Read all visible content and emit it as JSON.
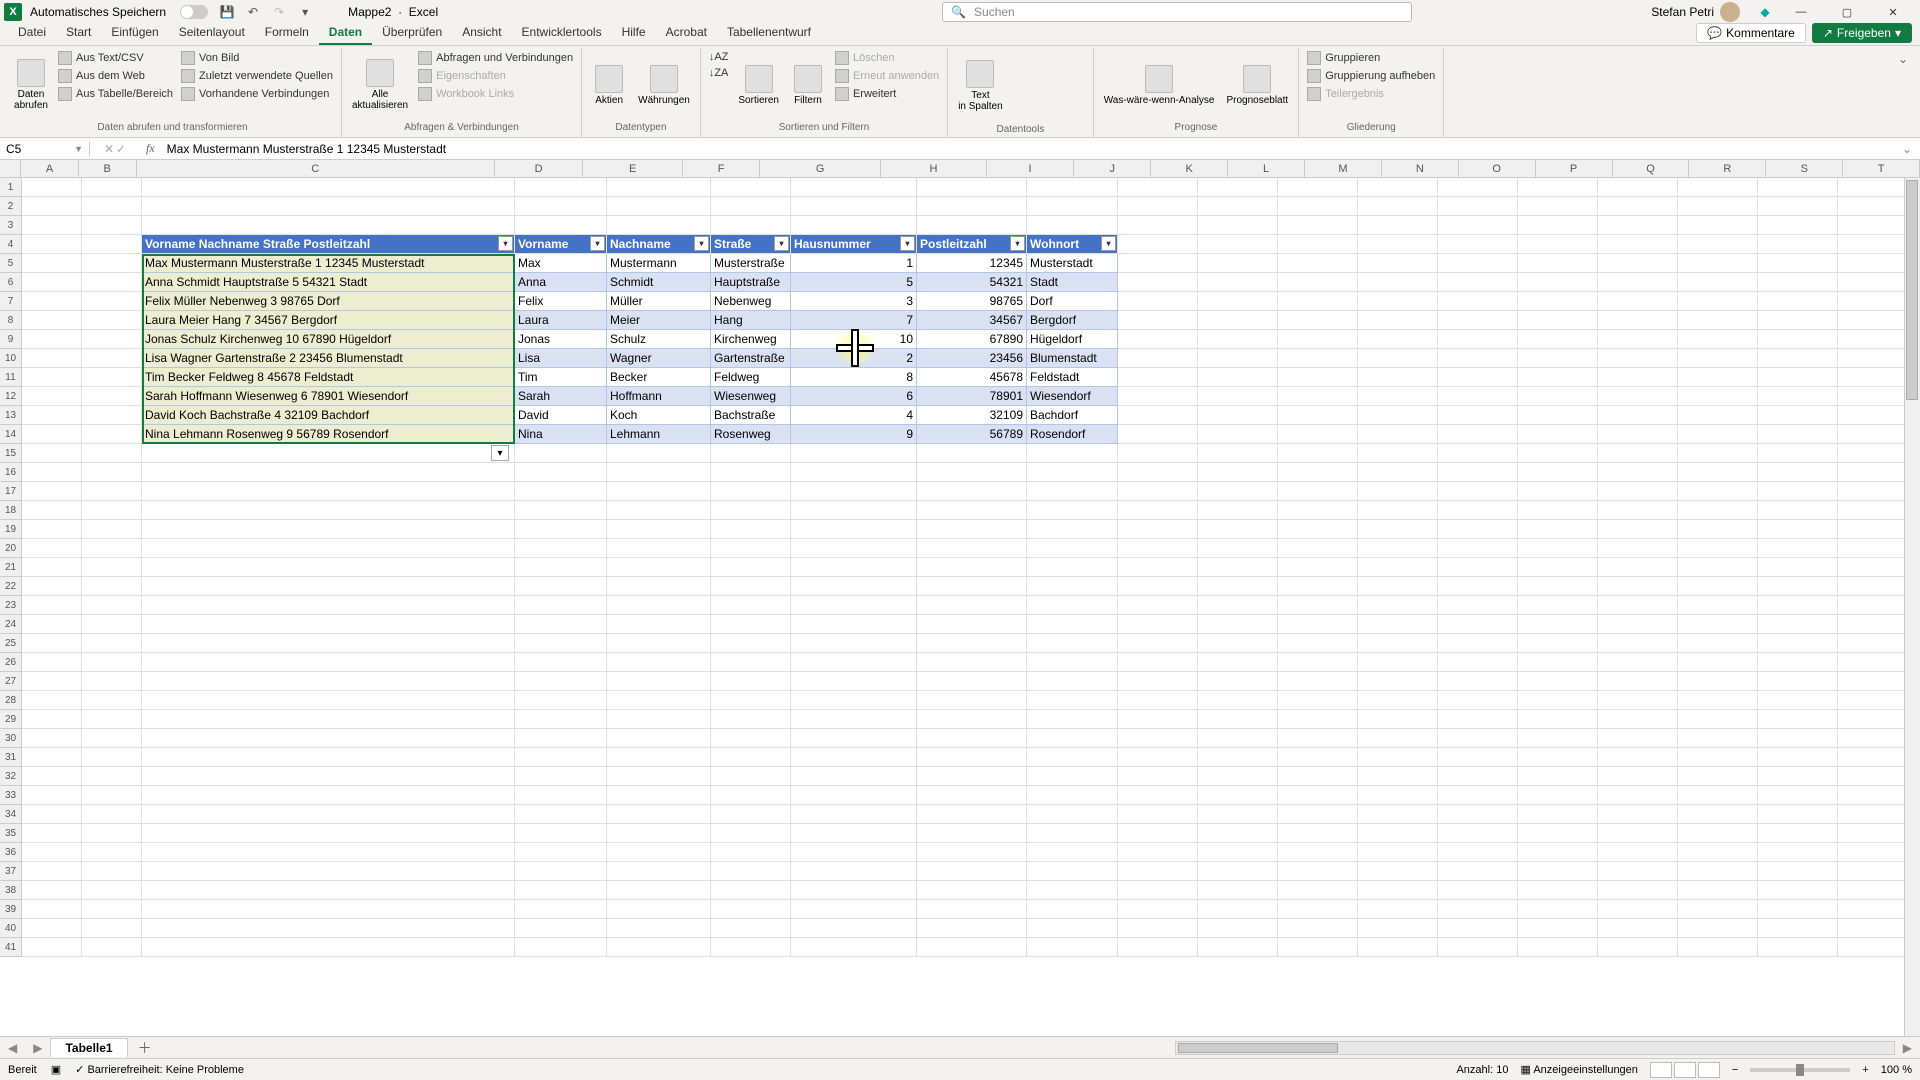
{
  "titlebar": {
    "auto_save": "Automatisches Speichern",
    "doc_name": "Mappe2",
    "app_name": "Excel",
    "search_placeholder": "Suchen",
    "user_name": "Stefan Petri"
  },
  "tabs": {
    "items": [
      "Datei",
      "Start",
      "Einfügen",
      "Seitenlayout",
      "Formeln",
      "Daten",
      "Überprüfen",
      "Ansicht",
      "Entwicklertools",
      "Hilfe",
      "Acrobat",
      "Tabellenentwurf"
    ],
    "active_index": 5,
    "comments_btn": "Kommentare",
    "share_btn": "Freigeben"
  },
  "ribbon": {
    "groups": [
      {
        "label": "Daten abrufen und transformieren",
        "big": {
          "label": "Daten abrufen"
        },
        "links": [
          "Aus Text/CSV",
          "Aus dem Web",
          "Aus Tabelle/Bereich",
          "Von Bild",
          "Zuletzt verwendete Quellen",
          "Vorhandene Verbindungen"
        ]
      },
      {
        "label": "Abfragen & Verbindungen",
        "big": {
          "label": "Alle aktualisieren"
        },
        "links": [
          "Abfragen und Verbindungen",
          "Eigenschaften",
          "Workbook Links"
        ],
        "disabled": [
          1,
          2
        ]
      },
      {
        "label": "Datentypen",
        "bigs": [
          {
            "label": "Aktien"
          },
          {
            "label": "Währungen"
          }
        ]
      },
      {
        "label": "Sortieren und Filtern",
        "bigs": [
          {
            "label": "Sortieren"
          },
          {
            "label": "Filtern"
          }
        ],
        "side_icons": [
          "↓AZ",
          "↓ZA"
        ],
        "links": [
          "Löschen",
          "Erneut anwenden",
          "Erweitert"
        ],
        "disabled": [
          0,
          1
        ]
      },
      {
        "label": "Datentools",
        "big": {
          "label": "Text in Spalten"
        }
      },
      {
        "label": "Prognose",
        "bigs": [
          {
            "label": "Was-wäre-wenn-Analyse"
          },
          {
            "label": "Prognoseblatt"
          }
        ]
      },
      {
        "label": "Gliederung",
        "links": [
          "Gruppieren",
          "Gruppierung aufheben",
          "Teilergebnis"
        ],
        "disabled": [
          2
        ]
      }
    ]
  },
  "formula_bar": {
    "cell_ref": "C5",
    "formula": "Max Mustermann Musterstraße 1 12345 Musterstadt"
  },
  "grid": {
    "columns": [
      "A",
      "B",
      "C",
      "D",
      "E",
      "F",
      "G",
      "H",
      "I",
      "J",
      "K",
      "L",
      "M",
      "N",
      "O",
      "P",
      "Q",
      "R",
      "S",
      "T"
    ],
    "row_count": 41,
    "table_headers_c": "Vorname Nachname Straße Postleitzahl",
    "split_headers": [
      "Vorname",
      "Nachname",
      "Straße",
      "Hausnummer",
      "Postleitzahl",
      "Wohnort"
    ],
    "raw_rows": [
      "Max Mustermann Musterstraße 1 12345 Musterstadt",
      "Anna Schmidt Hauptstraße 5 54321 Stadt",
      "Felix Müller Nebenweg 3 98765 Dorf",
      "Laura Meier Hang 7 34567 Bergdorf",
      "Jonas Schulz Kirchenweg 10 67890 Hügeldorf",
      "Lisa Wagner Gartenstraße 2 23456 Blumenstadt",
      "Tim Becker Feldweg 8 45678 Feldstadt",
      "Sarah Hoffmann Wiesenweg 6 78901 Wiesendorf",
      "David Koch Bachstraße 4 32109 Bachdorf",
      "Nina Lehmann Rosenweg 9 56789 Rosendorf"
    ],
    "split_rows": [
      [
        "Max",
        "Mustermann",
        "Musterstraße",
        "1",
        "12345",
        "Musterstadt"
      ],
      [
        "Anna",
        "Schmidt",
        "Hauptstraße",
        "5",
        "54321",
        "Stadt"
      ],
      [
        "Felix",
        "Müller",
        "Nebenweg",
        "3",
        "98765",
        "Dorf"
      ],
      [
        "Laura",
        "Meier",
        "Hang",
        "7",
        "34567",
        "Bergdorf"
      ],
      [
        "Jonas",
        "Schulz",
        "Kirchenweg",
        "10",
        "67890",
        "Hügeldorf"
      ],
      [
        "Lisa",
        "Wagner",
        "Gartenstraße",
        "2",
        "23456",
        "Blumenstadt"
      ],
      [
        "Tim",
        "Becker",
        "Feldweg",
        "8",
        "45678",
        "Feldstadt"
      ],
      [
        "Sarah",
        "Hoffmann",
        "Wiesenweg",
        "6",
        "78901",
        "Wiesendorf"
      ],
      [
        "David",
        "Koch",
        "Bachstraße",
        "4",
        "32109",
        "Bachdorf"
      ],
      [
        "Nina",
        "Lehmann",
        "Rosenweg",
        "9",
        "56789",
        "Rosendorf"
      ]
    ]
  },
  "sheet_tabs": {
    "active": "Tabelle1"
  },
  "status_bar": {
    "ready": "Bereit",
    "accessibility": "Barrierefreiheit: Keine Probleme",
    "count_label": "Anzahl:",
    "count_value": "10",
    "display_settings": "Anzeigeeinstellungen",
    "zoom": "100 %"
  }
}
